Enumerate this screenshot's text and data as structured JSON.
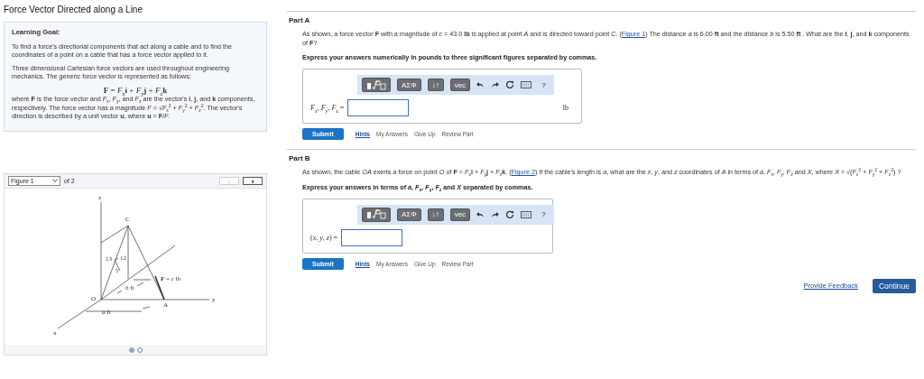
{
  "title": "Force Vector Directed along a Line",
  "learning_goal": {
    "heading": "Learning Goal:",
    "paragraphs": [
      {
        "kind": "text",
        "text": "To find a force's directional components that act along a cable and to find the coordinates of a point on a cable that has a force vector applied to it."
      },
      {
        "kind": "text",
        "text": "Three dimensional Cartesian force vectors are used throughout engineering mechanics. The generic force vector is represented as follows:"
      },
      {
        "kind": "equation",
        "text": "**F** = *F*$_{x}$**i** + *F*$_{y}$**j** + *F*$_{z}$**k**"
      },
      {
        "kind": "text",
        "text": "where **F** is the force vector and *F*$_{x}$, *F*$_{y}$, and *F*$_{z}$ are the vector's **i**, **j**, and **k** components, respectively. The force vector has a magnitude *F* = √*F*$_{x}$$^{2}$ + *F*$_{y}$$^{2}$ + *F*$_{z}$$^{2}$. The vector's direction is described by a unit vector **u**, where **u** = **F**/*F*."
      }
    ]
  },
  "figure": {
    "select": "Figure 1",
    "count": "of 2",
    "prev": {
      "label": "‹",
      "disabled": true
    },
    "next": {
      "label": "›",
      "disabled": false
    },
    "labels": [
      "z",
      "C",
      "13",
      "12",
      "5",
      "**F** = *c* lb",
      "*b* ft",
      "O",
      "A",
      "y",
      "*a* ft",
      "x"
    ],
    "dots": [
      {
        "selected": true
      },
      {
        "selected": false
      }
    ]
  },
  "parts": [
    {
      "title": "Part A",
      "question_before": "As shown, a force vector **F** with a magnitude of *c* = 43.0 **lb** is applied at point *A* and is directed toward point *C*. (",
      "link": "Figure 1",
      "question_after": ") The distance *a* is 6.00 **ft** and the distance *b* is 5.50 **ft** . What are the **i**, **j**, and **k** components of **F**?",
      "instruction": "Express your answers numerically in pounds to three significant figures separated by commas.",
      "toolbar": [
        {
          "kind": "template"
        },
        {
          "kind": "boxed",
          "label": "ΑΣΦ"
        },
        {
          "kind": "boxed",
          "label": "↓↑"
        },
        {
          "kind": "boxed",
          "label": "vec"
        },
        {
          "kind": "undo"
        },
        {
          "kind": "redo"
        },
        {
          "kind": "reset"
        },
        {
          "kind": "keyboard"
        },
        {
          "kind": "plain",
          "label": "?"
        }
      ],
      "answer_label": "*F*$_{x}$, *F*$_{y}$, *F*$_{z}$ =",
      "unit": "lb",
      "submit": "Submit",
      "links": [
        "Hints",
        "My Answers",
        "Give Up",
        "Review Part"
      ]
    },
    {
      "title": "Part B",
      "question_before": "As shown, the cable *OA* exerts a force on point *O* of **F** = *F*$_{x}$**i** + *F*$_{y}$**j** + *F*$_{z}$**k**. (",
      "link": "Figure 2",
      "question_after": ") If the cable's length is *a*, what are the *x*, *y*, and *z* coordinates of *A* in terms of *a*, *F*$_{x}$, *F*$_{y}$, *F*$_{z}$ and *X*, where *X* = √(*F*$_{x}$$^{2}$ + *F*$_{y}$$^{2}$ + *F*$_{z}$$^{2}$) ?",
      "instruction": "Express your answers in terms of *a*, *F*$_{x}$, *F*$_{y}$, *F*$_{z}$ and *X* separated by commas.",
      "toolbar": [
        {
          "kind": "template"
        },
        {
          "kind": "boxed",
          "label": "ΑΣΦ"
        },
        {
          "kind": "boxed",
          "label": "↓↑"
        },
        {
          "kind": "boxed",
          "label": "vec"
        },
        {
          "kind": "undo"
        },
        {
          "kind": "redo"
        },
        {
          "kind": "reset"
        },
        {
          "kind": "keyboard"
        },
        {
          "kind": "plain",
          "label": "?"
        }
      ],
      "answer_label": "(*x*, *y*, *z*) =",
      "submit": "Submit",
      "links": [
        "Hints",
        "My Answers",
        "Give Up",
        "Review Part"
      ]
    }
  ],
  "footer": {
    "feedback": "Provide Feedback",
    "continue": "Continue"
  }
}
